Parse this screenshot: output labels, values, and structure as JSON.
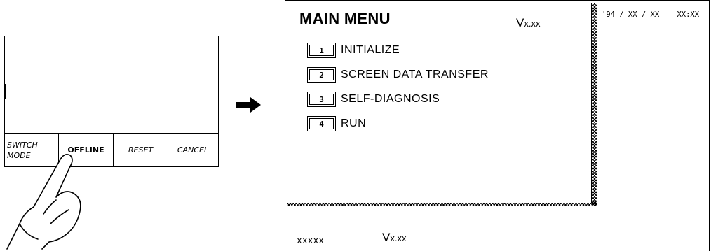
{
  "left_panel": {
    "mode_keys": [
      "SWITCH MODE",
      "OFFLINE",
      "RESET",
      "CANCEL"
    ],
    "switch_mode_lines": [
      "SWITCH",
      "MODE"
    ]
  },
  "main_menu": {
    "title": "MAIN MENU",
    "version_prefix": "V",
    "version_suffix": "x.xx",
    "items": [
      {
        "number": "1",
        "label": "INITIALIZE"
      },
      {
        "number": "2",
        "label": "SCREEN DATA TRANSFER"
      },
      {
        "number": "3",
        "label": "SELF-DIAGNOSIS"
      },
      {
        "number": "4",
        "label": "RUN"
      }
    ],
    "datetime": "'94 / XX / XX    XX:XX"
  },
  "status_bar": {
    "model": "xxxxx",
    "version_prefix": "V",
    "version_suffix": "x.xx"
  },
  "icons": {
    "arrow": "right-arrow-icon",
    "hand": "pointing-hand-icon"
  }
}
